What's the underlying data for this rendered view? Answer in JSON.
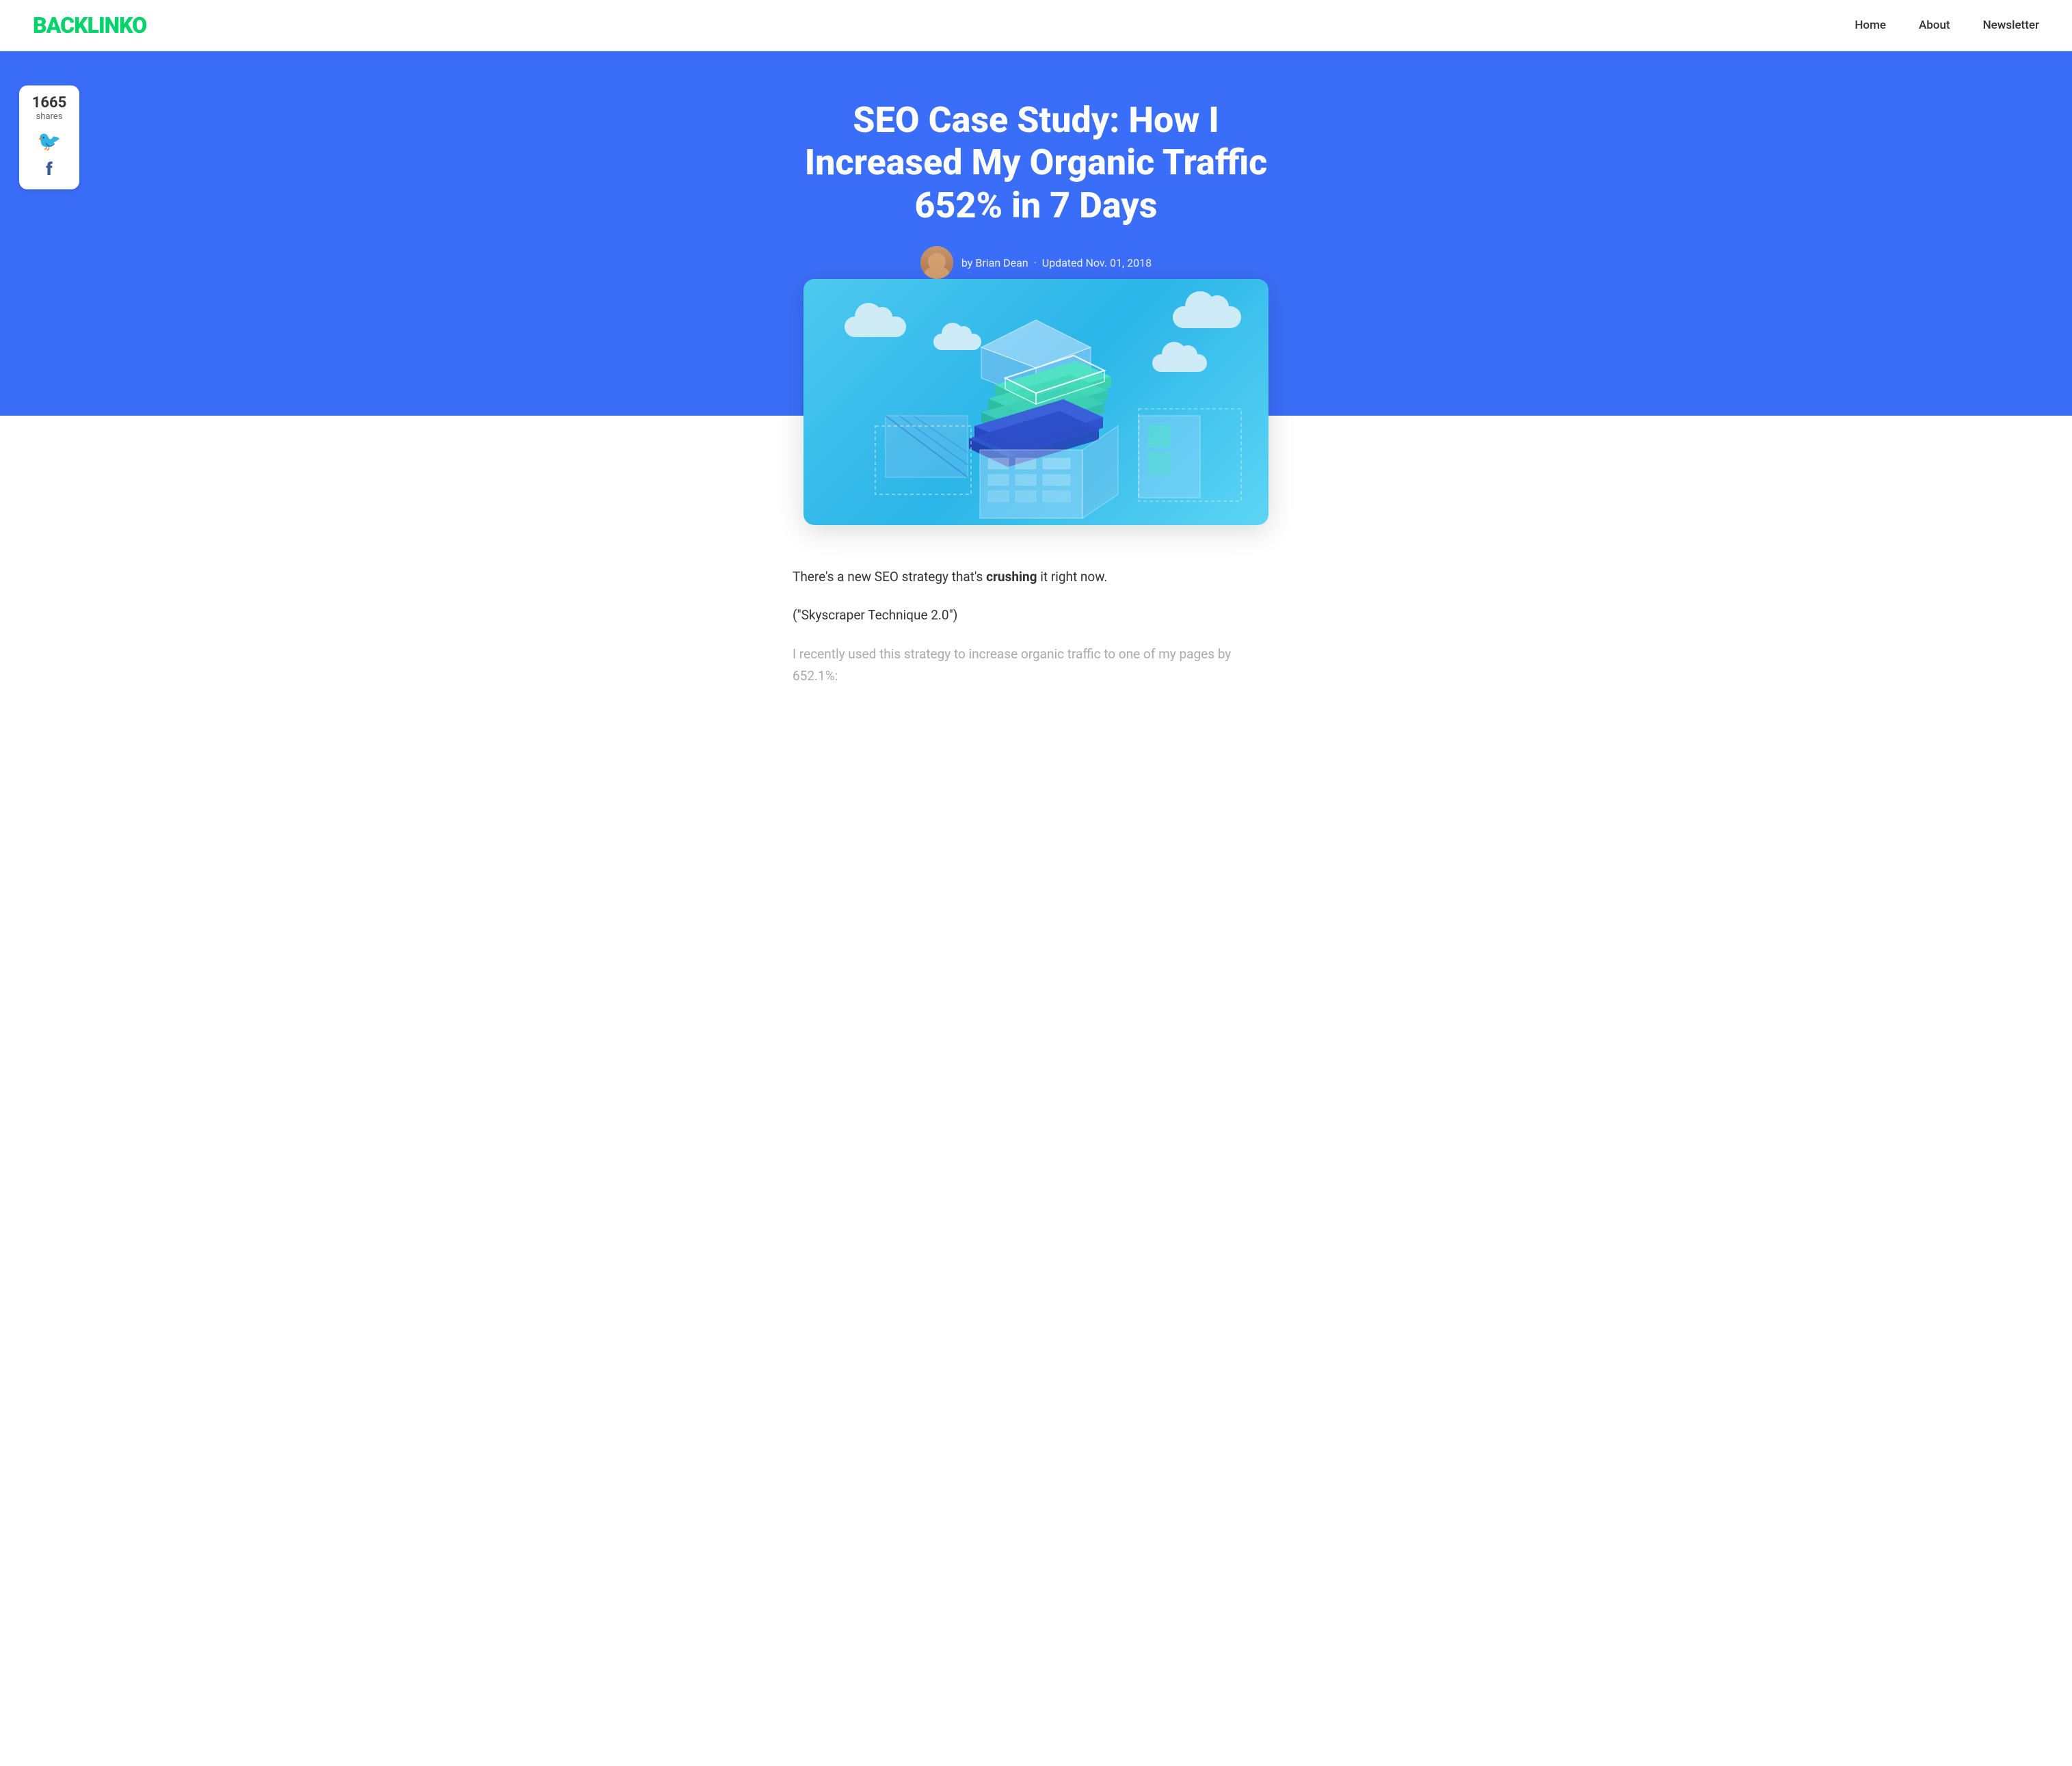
{
  "header": {
    "logo": "BACKLINKO",
    "nav": {
      "home": "Home",
      "about": "About",
      "newsletter": "Newsletter"
    }
  },
  "hero": {
    "title": "SEO Case Study: How I Increased My Organic Traffic 652% in 7 Days",
    "author": "by Brian Dean",
    "updated": "Updated Nov. 01, 2018"
  },
  "share": {
    "count": "1665",
    "label": "shares"
  },
  "content": {
    "intro": "There's a new SEO strategy that's ",
    "intro_bold": "crushing",
    "intro_end": " it right now.",
    "technique": "(\"Skyscraper Technique 2.0\")",
    "fade": "I recently used this strategy to increase organic traffic to one of my pages by 652.1%:"
  },
  "colors": {
    "brand_green": "#00d46a",
    "hero_blue": "#3b6ef8",
    "twitter_blue": "#1da1f2",
    "facebook_blue": "#3b5998"
  }
}
